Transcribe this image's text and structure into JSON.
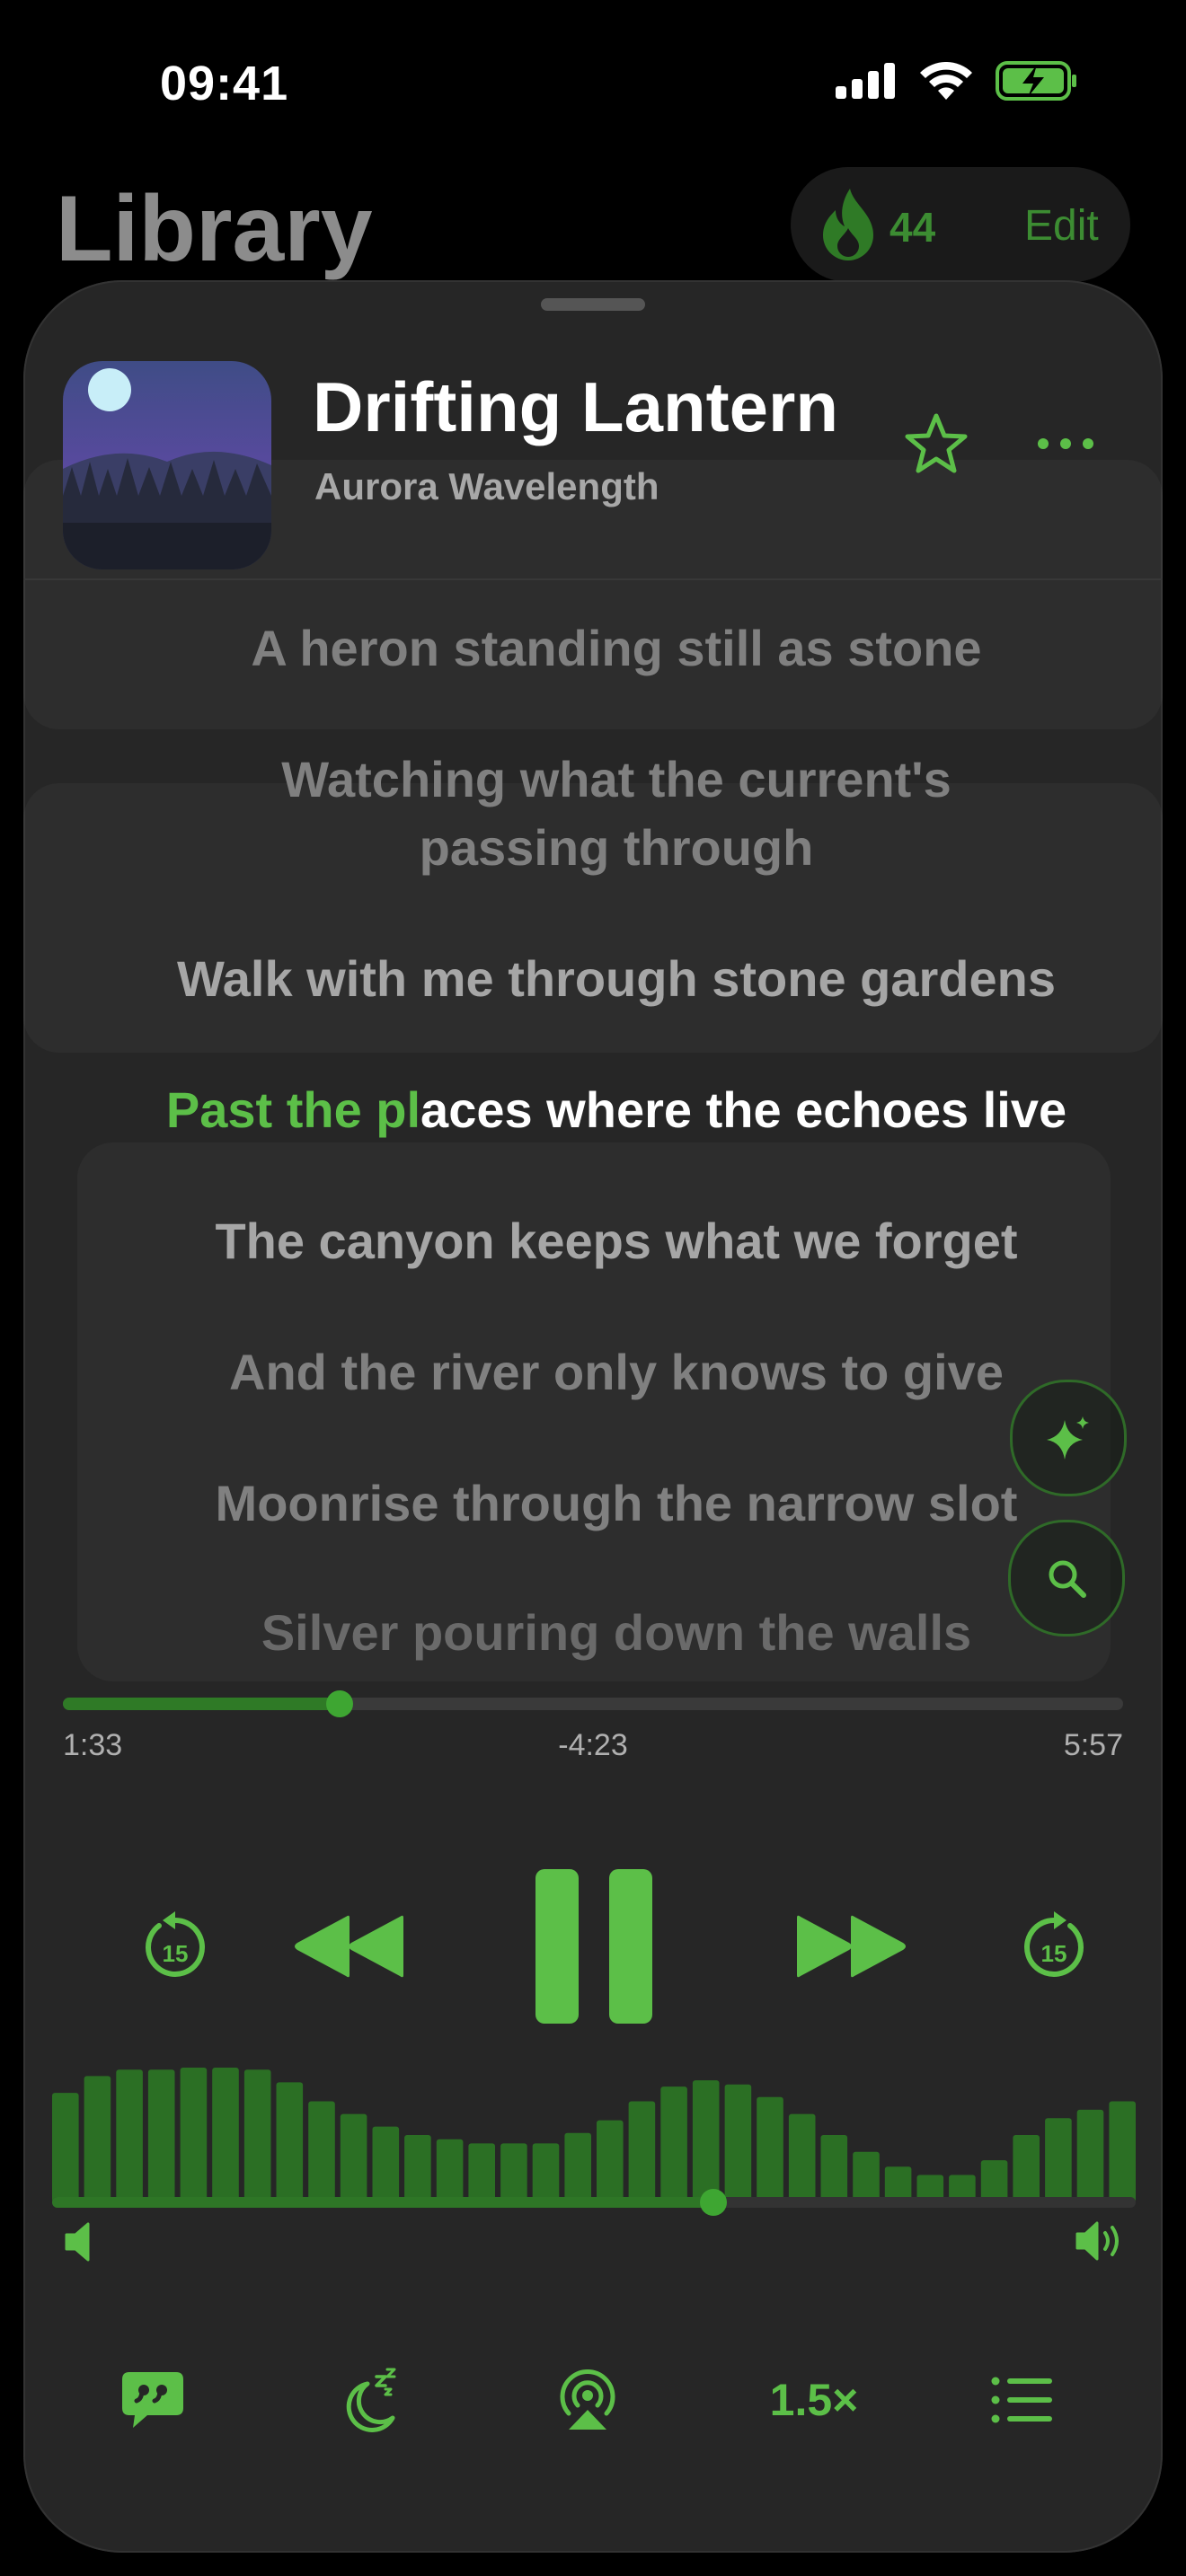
{
  "status_bar": {
    "time": "09:41"
  },
  "library": {
    "title": "Library",
    "streak_count": "44",
    "edit_label": "Edit"
  },
  "now_playing": {
    "title": "Drifting Lantern",
    "artist": "Aurora Wavelength"
  },
  "lyrics": [
    {
      "text": "A heron standing still as stone",
      "state": "past"
    },
    {
      "text": "Watching what the current's",
      "state": "past"
    },
    {
      "text": "passing through",
      "state": "past"
    },
    {
      "text": "Walk with me through stone gardens",
      "state": "previous"
    },
    {
      "sung": "Past the pl",
      "unsung": "aces where the echoes live",
      "state": "current"
    },
    {
      "text": "The canyon keeps what we forget",
      "state": "upcoming"
    },
    {
      "text": "And the river only knows to give",
      "state": "upcoming"
    },
    {
      "text": "Moonrise through the narrow slot",
      "state": "upcoming"
    },
    {
      "text": "Silver pouring down the walls",
      "state": "upcoming"
    }
  ],
  "playback": {
    "elapsed": "1:33",
    "remaining": "-4:23",
    "total": "5:57",
    "progress_fraction": 0.261,
    "is_playing": true,
    "skip_back_seconds": "15",
    "skip_forward_seconds": "15",
    "speed_label": "1.5×"
  },
  "volume": {
    "level_fraction": 0.61
  },
  "visualizer_levels": [
    0.52,
    0.6,
    0.63,
    0.63,
    0.64,
    0.64,
    0.63,
    0.57,
    0.48,
    0.42,
    0.36,
    0.32,
    0.3,
    0.28,
    0.28,
    0.28,
    0.33,
    0.39,
    0.48,
    0.55,
    0.58,
    0.56,
    0.5,
    0.42,
    0.32,
    0.24,
    0.17,
    0.13,
    0.13,
    0.2,
    0.32,
    0.4,
    0.44,
    0.48
  ],
  "colors": {
    "accent": "#5cbf48",
    "accent_dark": "#2f7a26",
    "sheet": "#262626",
    "background": "#000000"
  },
  "icons": {
    "star": "star-icon",
    "more": "ellipsis-icon",
    "sparkle": "sparkle-icon",
    "search": "search-icon",
    "lyrics": "quote-bubble-icon",
    "sleep": "moon-zzz-icon",
    "airplay": "airplay-icon",
    "queue": "list-icon"
  }
}
